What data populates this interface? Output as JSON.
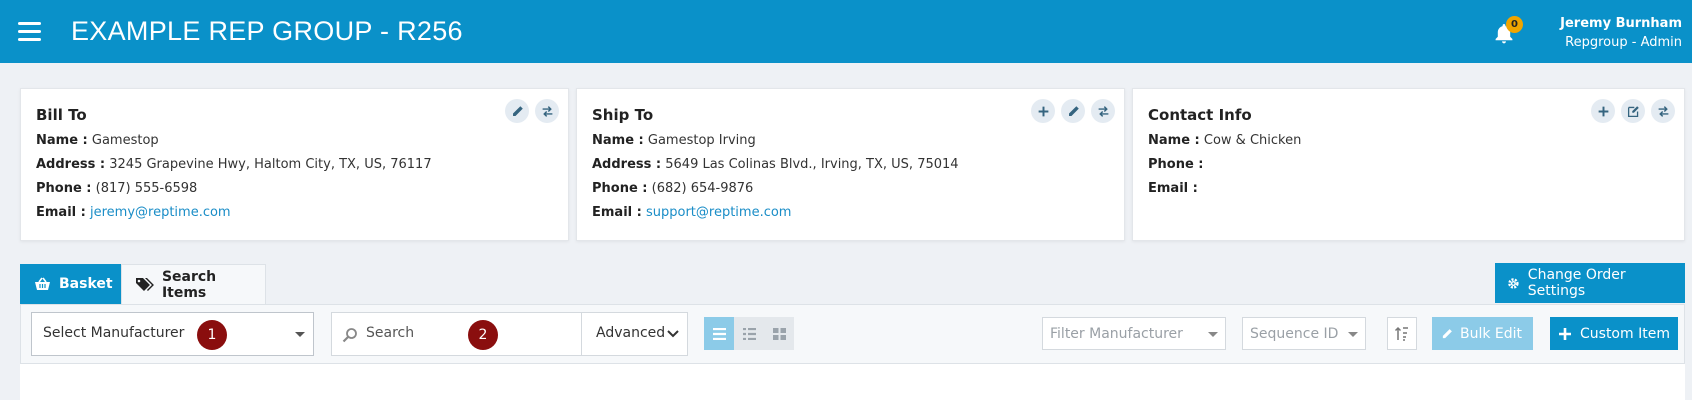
{
  "header": {
    "title": "EXAMPLE REP GROUP - R256",
    "notification_count": "0",
    "user_name": "Jeremy Burnham",
    "user_role": "Repgroup - Admin"
  },
  "cards": {
    "bill_to": {
      "title": "Bill To",
      "name_label": "Name :",
      "name": "Gamestop",
      "address_label": "Address :",
      "address": "3245 Grapevine Hwy, Haltom City, TX, US, 76117",
      "phone_label": "Phone :",
      "phone": "(817) 555-6598",
      "email_label": "Email :",
      "email": "jeremy@reptime.com"
    },
    "ship_to": {
      "title": "Ship To",
      "name_label": "Name :",
      "name": "Gamestop Irving",
      "address_label": "Address :",
      "address": "5649 Las Colinas Blvd., Irving, TX, US, 75014",
      "phone_label": "Phone :",
      "phone": "(682) 654-9876",
      "email_label": "Email :",
      "email": "support@reptime.com"
    },
    "contact": {
      "title": "Contact Info",
      "name_label": "Name :",
      "name": "Cow & Chicken",
      "phone_label": "Phone :",
      "phone": "",
      "email_label": "Email :",
      "email": ""
    }
  },
  "tabs": {
    "basket": "Basket",
    "search_items": "Search Items"
  },
  "change_order_settings": "Change Order Settings",
  "toolbar": {
    "select_manufacturer": "Select Manufacturer",
    "marker_1": "1",
    "search_placeholder": "Search",
    "marker_2": "2",
    "advanced": "Advanced",
    "filter_manufacturer": "Filter Manufacturer",
    "sequence_id": "Sequence ID",
    "bulk_edit": "Bulk Edit",
    "custom_item": "Custom Item"
  },
  "colors": {
    "brand": "#0a91c9",
    "brand_light": "#8ccbe8",
    "marker": "#8a0e0e",
    "badge": "#f0a500"
  },
  "icons": [
    "hamburger-icon",
    "bell-icon",
    "pencil-icon",
    "swap-icon",
    "plus-icon",
    "edit-square-icon",
    "basket-icon",
    "tags-icon",
    "gear-icon",
    "search-icon",
    "chevron-down-icon",
    "list-view-icon",
    "detail-view-icon",
    "grid-view-icon",
    "sort-icon"
  ]
}
